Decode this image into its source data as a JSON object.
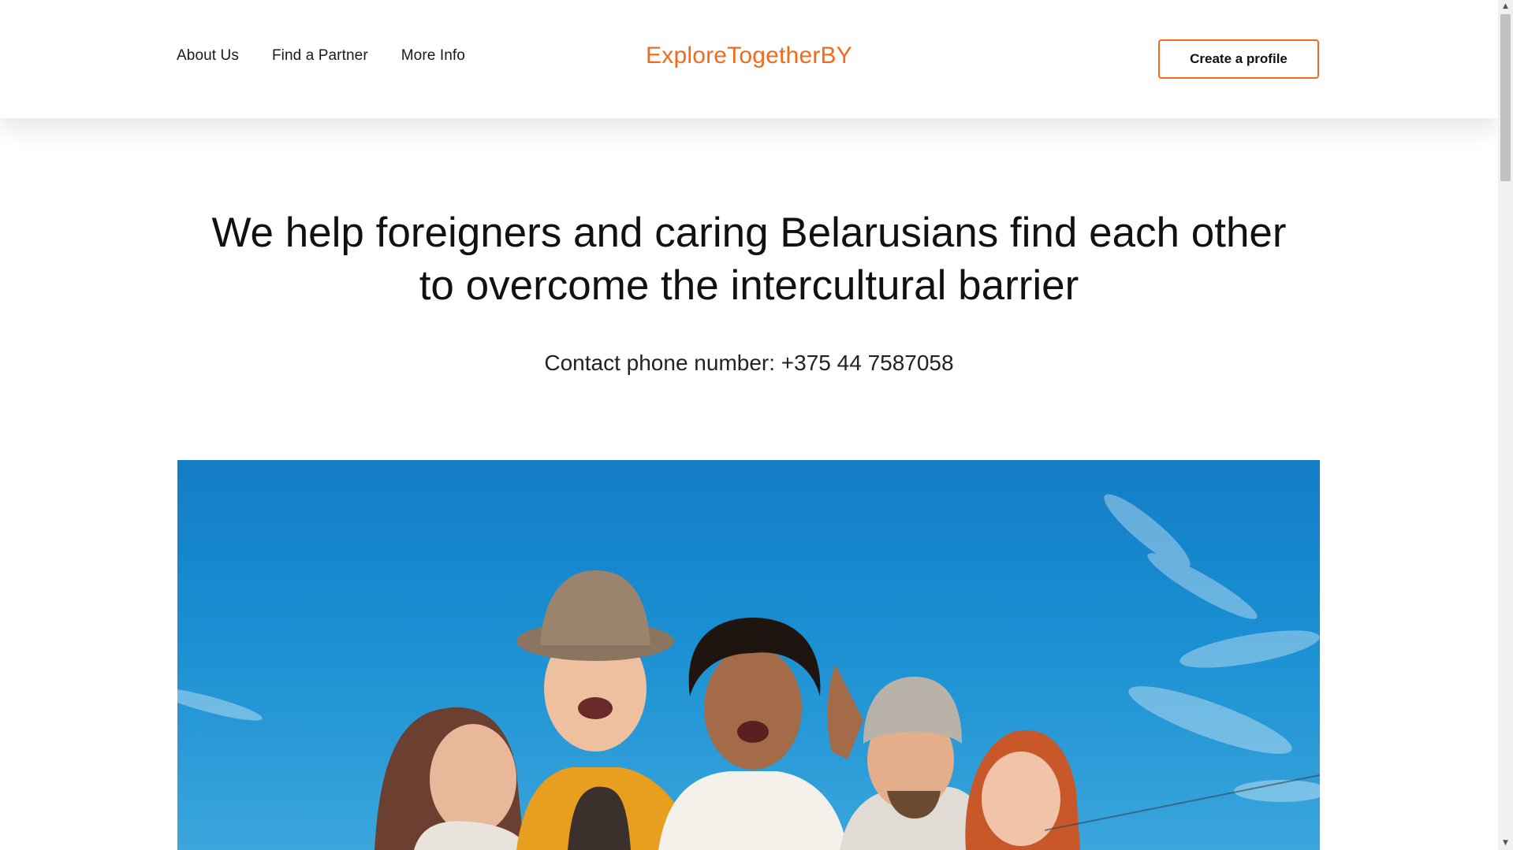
{
  "header": {
    "nav": [
      "About Us",
      "Find a Partner",
      "More Info"
    ],
    "logo": "ExploreTogetherBY",
    "cta_label": "Create a profile"
  },
  "hero": {
    "title_line1": "We help foreigners and caring Belarusians find each other",
    "title_line2": "to overcome the intercultural barrier",
    "contact": "Contact phone number: +375 44 7587058"
  },
  "photo": {
    "icon": "group-photo-icon"
  },
  "colors": {
    "accent": "#f26b1d",
    "sky": "#1a8fd2"
  }
}
